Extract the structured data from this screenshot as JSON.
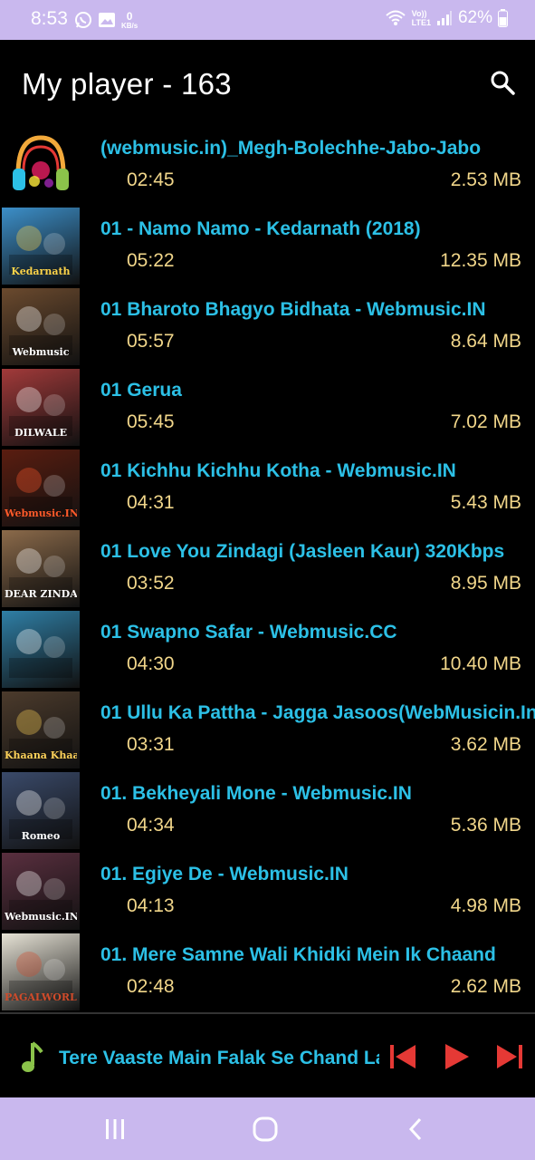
{
  "status_bar": {
    "time": "8:53",
    "net_speed": "0",
    "net_unit": "KB/s",
    "volte_top": "Vo))",
    "volte_bottom": "LTE1",
    "battery": "62%"
  },
  "app_bar": {
    "title": "My player - 163",
    "search_icon": "search-icon"
  },
  "colors": {
    "title": "#2cc0e6",
    "meta": "#f1d68a",
    "accent": "#e53935",
    "system_bar": "#c9b8ee"
  },
  "songs": [
    {
      "title": "(webmusic.in)_Megh-Bolechhe-Jabo-Jabo",
      "duration": "02:45",
      "size": "2.53 MB"
    },
    {
      "title": "01 - Namo Namo - Kedarnath (2018)",
      "duration": "05:22",
      "size": "12.35 MB"
    },
    {
      "title": "01 Bharoto Bhagyo Bidhata - Webmusic.IN",
      "duration": "05:57",
      "size": "8.64 MB"
    },
    {
      "title": "01 Gerua",
      "duration": "05:45",
      "size": "7.02 MB"
    },
    {
      "title": "01 Kichhu Kichhu Kotha - Webmusic.IN",
      "duration": "04:31",
      "size": "5.43 MB"
    },
    {
      "title": "01 Love You Zindagi (Jasleen Kaur) 320Kbps",
      "duration": "03:52",
      "size": "8.95 MB"
    },
    {
      "title": "01 Swapno Safar - Webmusic.CC",
      "duration": "04:30",
      "size": "10.40 MB"
    },
    {
      "title": "01 Ullu Ka Pattha - Jagga Jasoos(WebMusicin.In",
      "duration": "03:31",
      "size": "3.62 MB"
    },
    {
      "title": "01. Bekheyali Mone - Webmusic.IN",
      "duration": "04:34",
      "size": "5.36 MB"
    },
    {
      "title": "01. Egiye De - Webmusic.IN",
      "duration": "04:13",
      "size": "4.98 MB"
    },
    {
      "title": "01. Mere Samne Wali Khidki Mein Ik Chaand",
      "duration": "02:48",
      "size": "2.62 MB"
    }
  ],
  "thumbnails": [
    {
      "icon": "headphones-art-icon",
      "bg": "#000000",
      "fg": "#f2a93b",
      "text": ""
    },
    {
      "icon": "album-art-kedarnath",
      "bg": "#3c8fc9",
      "fg": "#ffd54a",
      "text": "Kedarnath"
    },
    {
      "icon": "album-art-crowd",
      "bg": "#6b4a2e",
      "fg": "#ffffff",
      "text": "Webmusic"
    },
    {
      "icon": "album-art-dilwale",
      "bg": "#a23a3a",
      "fg": "#ffffff",
      "text": "DILWALE"
    },
    {
      "icon": "album-art-fire",
      "bg": "#5a1d10",
      "fg": "#ff5a2a",
      "text": "Webmusic.IN"
    },
    {
      "icon": "album-art-dear-zindagi",
      "bg": "#8b6a4a",
      "fg": "#ffffff",
      "text": "DEAR ZINDAGI"
    },
    {
      "icon": "album-art-couple",
      "bg": "#2f7fa6",
      "fg": "#ffffff",
      "text": ""
    },
    {
      "icon": "album-art-jagga",
      "bg": "#4c3b2c",
      "fg": "#ffd35a",
      "text": "Khaana Khaake"
    },
    {
      "icon": "album-art-romeo",
      "bg": "#3a4a6a",
      "fg": "#ffffff",
      "text": "Romeo"
    },
    {
      "icon": "album-art-egiye",
      "bg": "#5a2f3f",
      "fg": "#ffffff",
      "text": "Webmusic.IN"
    },
    {
      "icon": "album-art-dancers",
      "bg": "#e7e3d6",
      "fg": "#d04b2a",
      "text": "PAGALWORLD.COM"
    }
  ],
  "now_playing": {
    "title": "Tere Vaaste Main Falak Se Chand La",
    "music_icon": "music-note-icon",
    "prev_icon": "skip-previous-icon",
    "play_icon": "play-icon",
    "next_icon": "skip-next-icon"
  },
  "nav_bar": {
    "recents_icon": "recents-icon",
    "home_icon": "home-icon",
    "back_icon": "back-icon"
  }
}
